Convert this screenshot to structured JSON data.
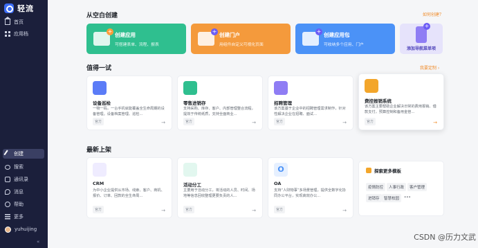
{
  "app": {
    "logo_text": "轻流"
  },
  "sidebar": {
    "top_items": [
      {
        "label": "首页",
        "icon": "home-icon"
      },
      {
        "label": "应用档",
        "icon": "grid-icon"
      }
    ],
    "bottom_items": [
      {
        "label": "创建",
        "icon": "pen-icon",
        "active": true
      },
      {
        "label": "搜索",
        "icon": "search-icon"
      },
      {
        "label": "通讯录",
        "icon": "contacts-icon"
      },
      {
        "label": "消息",
        "icon": "message-icon"
      },
      {
        "label": "帮助",
        "icon": "help-icon"
      },
      {
        "label": "更多",
        "icon": "more-icon"
      }
    ],
    "user": {
      "name": "yuhuijing"
    },
    "collapse_icon": "«"
  },
  "create_blank": {
    "title": "从空白创建",
    "link": "如何创建？",
    "banners": [
      {
        "title": "创建应用",
        "subtitle": "可搭建表单、流程、报表"
      },
      {
        "title": "创建门户",
        "subtitle": "用组件自定义可视化页面"
      },
      {
        "title": "创建应用包",
        "subtitle": "可收纳多个应用、门户"
      },
      {
        "title": "添加导航菜单项",
        "subtitle": ""
      }
    ]
  },
  "try_section": {
    "title": "值得一试",
    "link": "我要定制 ›",
    "cards": [
      {
        "title": "设备巡检",
        "desc": "一物一码，一台手机就能覆盖全生命周期的设备管理。设备档案管理、巡检...",
        "tag": "官方",
        "icon_color": "#5b7cf7"
      },
      {
        "title": "零售进销存",
        "desc": "支持采购、库存、客户、内部管理整合流程，提效于传统纸质，支持全面商业...",
        "tag": "官方",
        "icon_color": "#2fbf8f"
      },
      {
        "title": "招聘管理",
        "desc": "该方案基于企业中的招聘管理需求制作，针对性解决企业在招聘、面试...",
        "tag": "官方",
        "icon_color": "#8f7df4"
      },
      {
        "title": "费控报销系统",
        "desc": "该方案主要帮助企业解决日常的费用报销、借款支付，预算控制和备用金管...",
        "tag": "官方",
        "icon_color": "#f3a62b"
      }
    ]
  },
  "new_section": {
    "title": "最新上架",
    "cards": [
      {
        "title": "CRM",
        "desc": "为中小企业提供从市场、线索、客户、商机、报价、订单、回款的全生命周...",
        "tag": "官方",
        "icon_color": "#6b5cf5"
      },
      {
        "title": "活动分工",
        "desc": "主要用于活动分工，将活动的人员、时间、场地等信息回收整理更要负责的人...",
        "tag": "官方",
        "icon_color": "#2fbf8f"
      },
      {
        "title": "OA",
        "desc": "支持“人财物事”多场景管理，提供全数字化协同办公平台，实现高效办公...",
        "tag": "官方",
        "icon_color": "#4b92f7",
        "icon_text": "O"
      }
    ],
    "explore": {
      "title": "探索更多模板",
      "tags": [
        "疫情防控",
        "人事行政",
        "客户管理",
        "进销存",
        "智慧校园",
        "•••"
      ]
    }
  },
  "watermark": "CSDN @历力文武"
}
